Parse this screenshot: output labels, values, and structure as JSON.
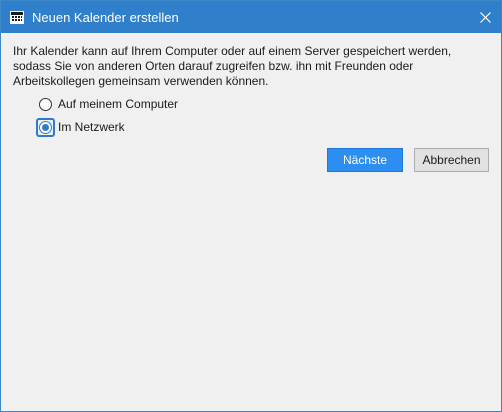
{
  "window": {
    "title": "Neuen Kalender erstellen",
    "title_icon": "calendar-icon",
    "close_icon": "close-icon",
    "accent_color": "#2f7fca"
  },
  "description": "Ihr Kalender kann auf Ihrem Computer oder auf einem Server gespeichert werden, sodass Sie von anderen Orten darauf zugreifen bzw. ihn mit Freunden oder Arbeitskollegen gemeinsam verwenden können.",
  "options": [
    {
      "label": "Auf meinem Computer",
      "checked": false
    },
    {
      "label": "Im Netzwerk",
      "checked": true
    }
  ],
  "buttons": {
    "next_label": "Nächste",
    "cancel_label": "Abbrechen",
    "primary_color": "#2b8ef0"
  }
}
